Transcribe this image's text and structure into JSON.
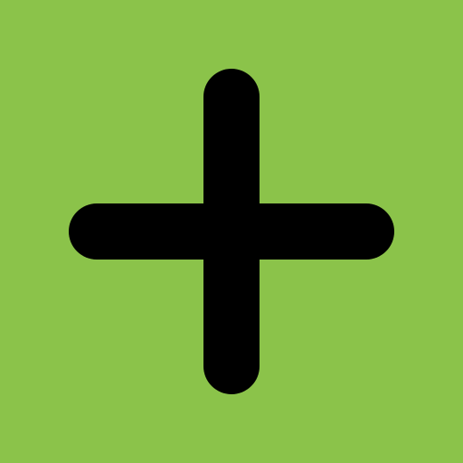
{
  "button": {
    "icon": "plus-icon",
    "background_color": "#8bc34a",
    "icon_color": "#000000"
  }
}
